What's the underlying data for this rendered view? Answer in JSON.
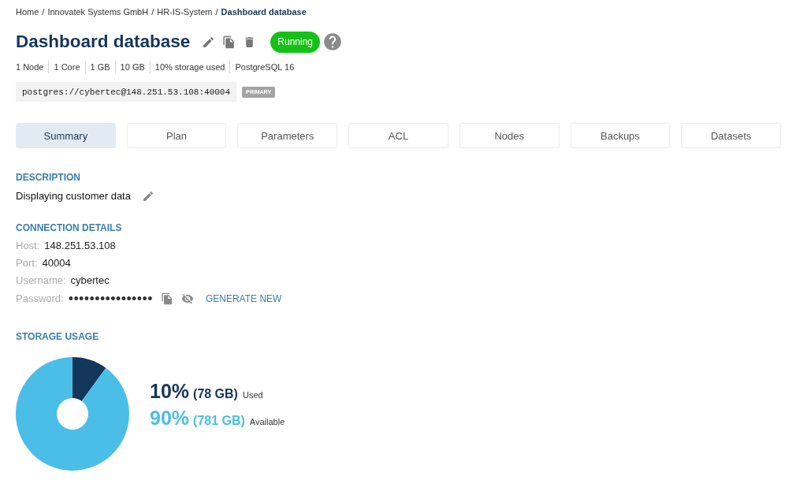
{
  "breadcrumb": {
    "separator": "/",
    "items": [
      {
        "label": "Home",
        "current": false
      },
      {
        "label": "Innovatek Systems GmbH",
        "current": false
      },
      {
        "label": "HR-IS-System",
        "current": false
      },
      {
        "label": "Dashboard database",
        "current": true
      }
    ]
  },
  "title": "Dashboard database",
  "status": {
    "label": "Running",
    "kind": "running"
  },
  "meta": [
    "1 Node",
    "1 Core",
    "1 GB",
    "10 GB",
    "10% storage used",
    "PostgreSQL 16"
  ],
  "connection_string": {
    "value": "postgres://cybertec@148.251.53.108:40004",
    "badge": "PRIMARY"
  },
  "tabs": [
    {
      "label": "Summary",
      "selected": true
    },
    {
      "label": "Plan",
      "selected": false
    },
    {
      "label": "Parameters",
      "selected": false
    },
    {
      "label": "ACL",
      "selected": false
    },
    {
      "label": "Nodes",
      "selected": false
    },
    {
      "label": "Backups",
      "selected": false
    },
    {
      "label": "Datasets",
      "selected": false
    }
  ],
  "description": {
    "heading": "DESCRIPTION",
    "text": "Displaying customer data"
  },
  "connection_details": {
    "heading": "CONNECTION DETAILS",
    "fields": [
      {
        "label": "Host:",
        "value": "148.251.53.108",
        "kind": "text"
      },
      {
        "label": "Port:",
        "value": "40004",
        "kind": "text"
      },
      {
        "label": "Username:",
        "value": "cybertec",
        "kind": "text"
      },
      {
        "label": "Password:",
        "value": "••••••••••••••••",
        "kind": "secret"
      }
    ],
    "action": "GENERATE NEW"
  },
  "storage": {
    "heading": "STORAGE USAGE",
    "legend": [
      {
        "percent": "10%",
        "amount": "(78 GB)",
        "color": "#14365a"
      },
      {
        "percent": "90%",
        "amount": "(781 GB)",
        "color": "#4bbee8"
      }
    ],
    "chart_data": {
      "type": "donut",
      "categories": [
        "Used",
        "Available"
      ],
      "values": [
        10,
        90
      ]
    }
  }
}
